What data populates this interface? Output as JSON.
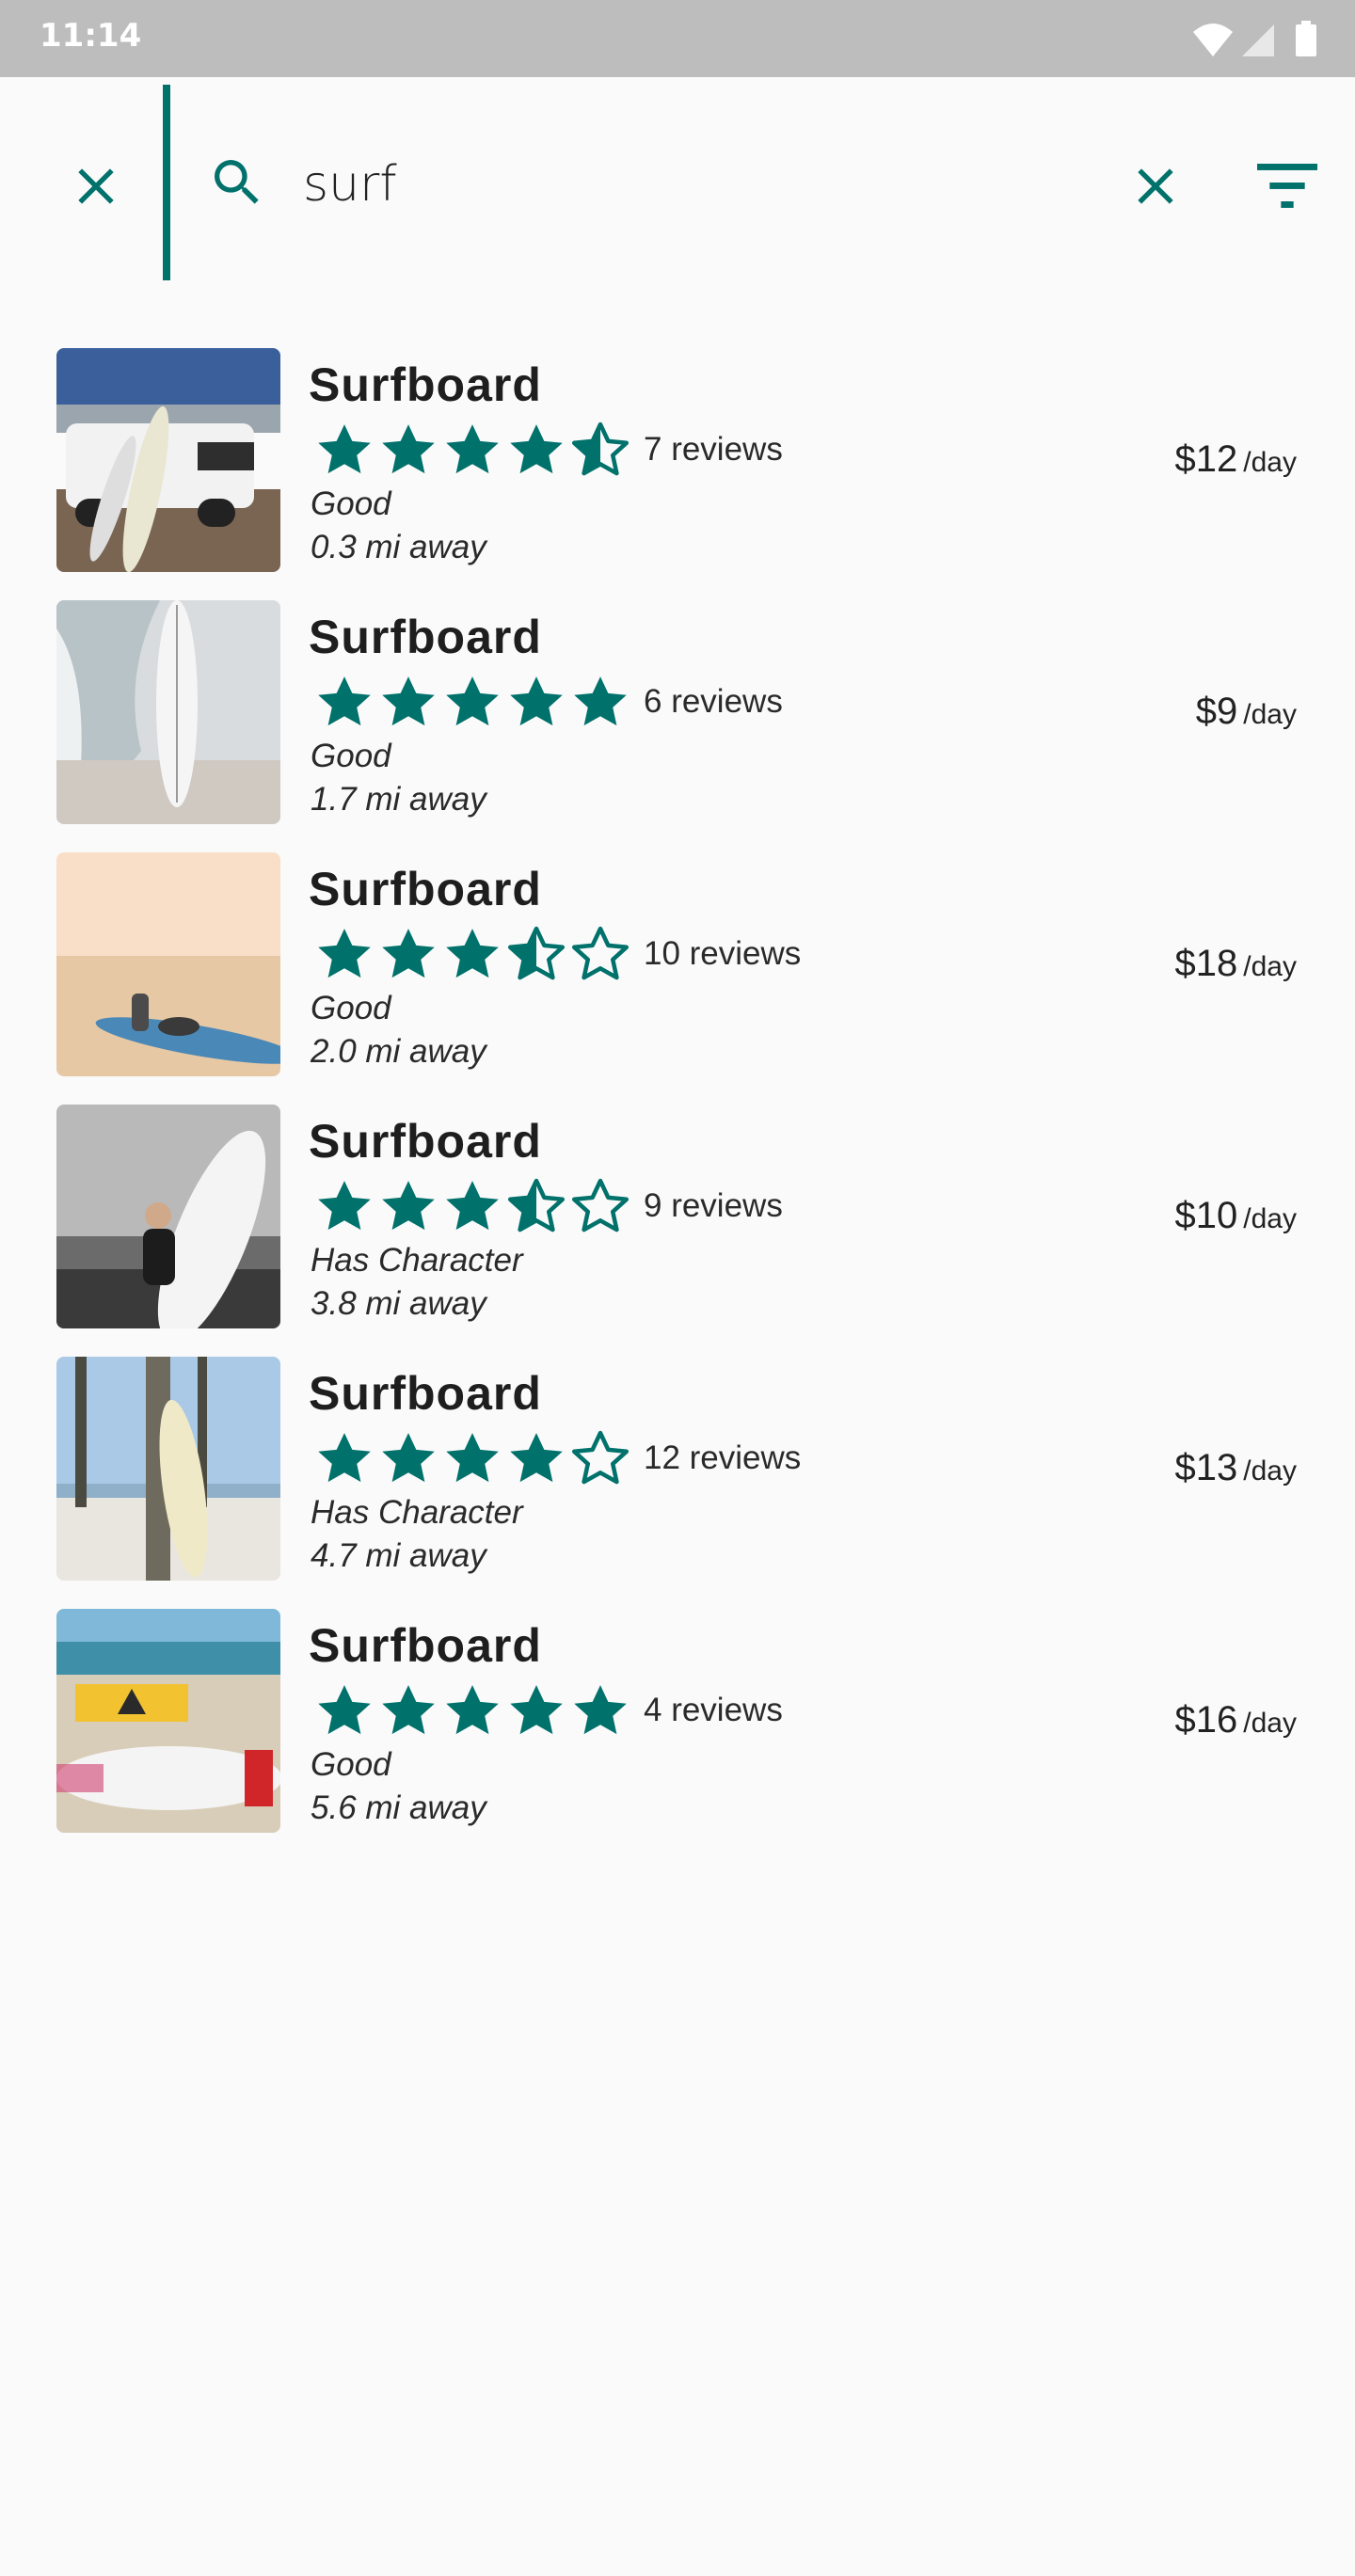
{
  "status_bar": {
    "time": "11:14"
  },
  "search": {
    "value": "surf"
  },
  "colors": {
    "accent": "#00716b",
    "status_bar": "#bdbdbd"
  },
  "results": [
    {
      "title": "Surfboard",
      "rating": 4.5,
      "reviews": "7 reviews",
      "condition": "Good",
      "distance": "0.3 mi away",
      "price": "$12",
      "unit": "/day",
      "photo": "surfboard-by-suv-photo"
    },
    {
      "title": "Surfboard",
      "rating": 5,
      "reviews": "6 reviews",
      "condition": "Good",
      "distance": "1.7 mi away",
      "price": "$9",
      "unit": "/day",
      "photo": "surfboard-on-shore-photo"
    },
    {
      "title": "Surfboard",
      "rating": 3.5,
      "reviews": "10 reviews",
      "condition": "Good",
      "distance": "2.0 mi away",
      "price": "$18",
      "unit": "/day",
      "photo": "paddleboard-on-beach-photo"
    },
    {
      "title": "Surfboard",
      "rating": 3.5,
      "reviews": "9 reviews",
      "condition": "Has Character",
      "distance": "3.8 mi away",
      "price": "$10",
      "unit": "/day",
      "photo": "surfer-holding-board-photo"
    },
    {
      "title": "Surfboard",
      "rating": 4,
      "reviews": "12 reviews",
      "condition": "Has Character",
      "distance": "4.7 mi away",
      "price": "$13",
      "unit": "/day",
      "photo": "board-against-palm-photo"
    },
    {
      "title": "Surfboard",
      "rating": 5,
      "reviews": "4 reviews",
      "condition": "Good",
      "distance": "5.6 mi away",
      "price": "$16",
      "unit": "/day",
      "photo": "board-by-warning-sign-photo"
    }
  ]
}
